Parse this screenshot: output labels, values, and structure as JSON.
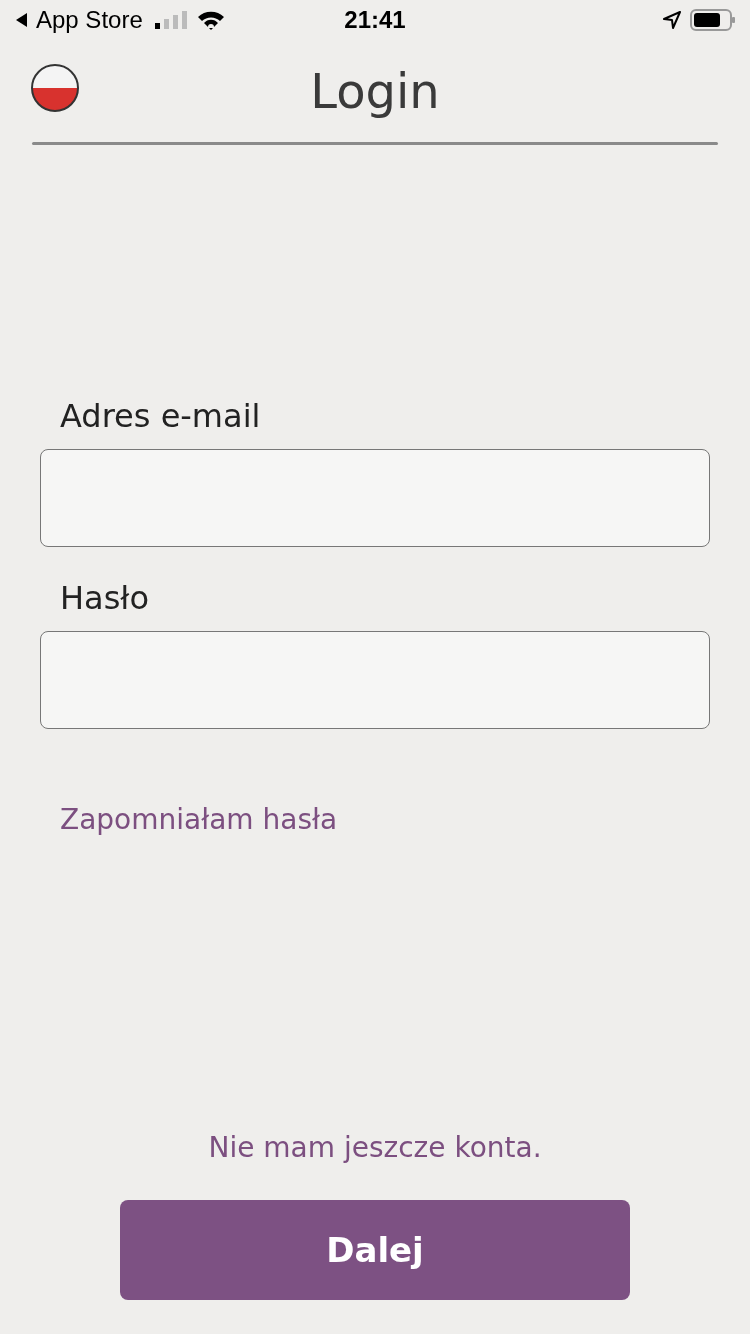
{
  "status_bar": {
    "back_label": "App Store",
    "time": "21:41"
  },
  "header": {
    "title": "Login"
  },
  "fields": [
    {
      "label": "Adres e-mail"
    },
    {
      "label": "Hasło"
    }
  ],
  "forgot_link": "Zapomniałam hasła",
  "signup_link": "Nie mam jeszcze konta.",
  "submit_button": "Dalej"
}
